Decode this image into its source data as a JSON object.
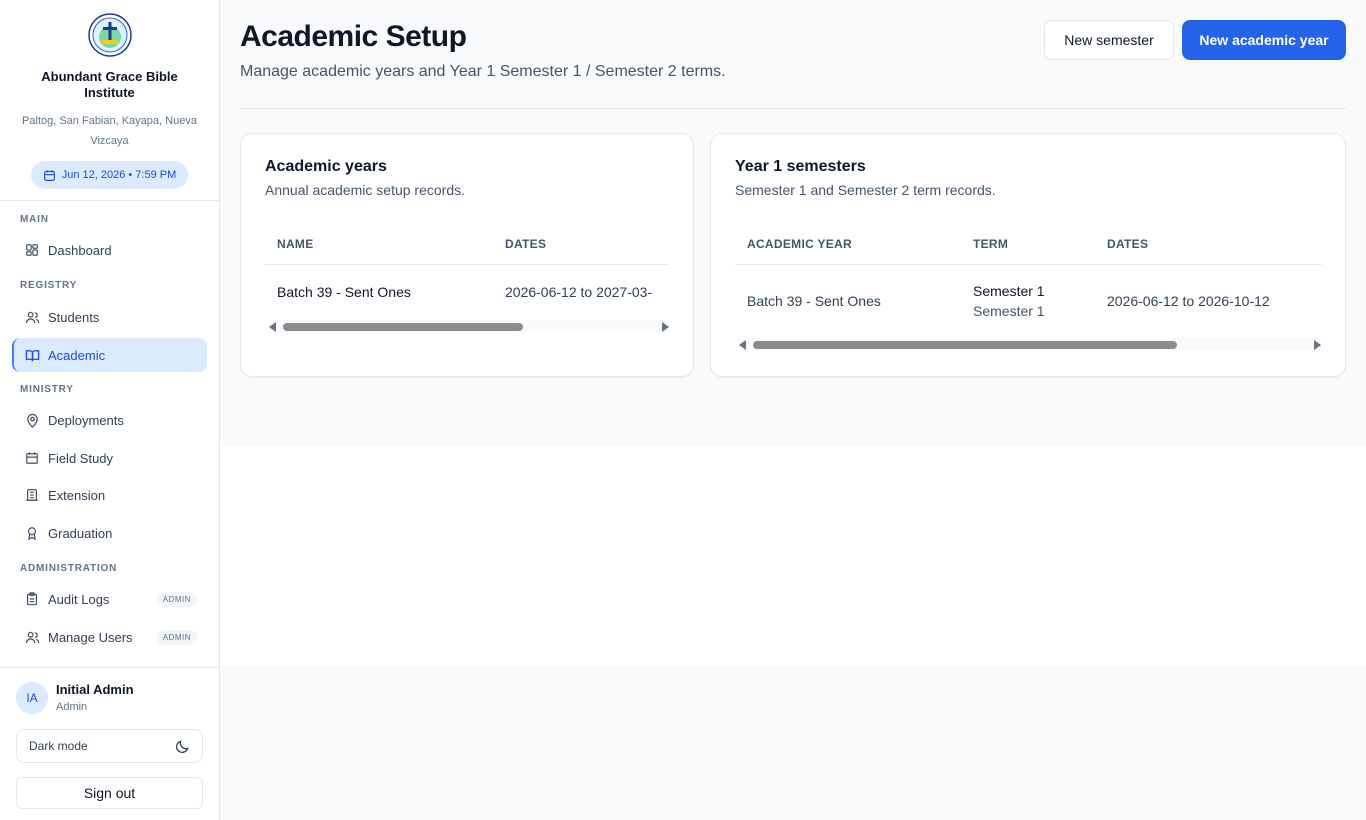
{
  "brand": {
    "name": "Abundant Grace Bible Institute",
    "address": "Paltog, San Fabian, Kayapa, Nueva Vizcaya",
    "datetime": "Jun 12, 2026 • 7:59 PM"
  },
  "nav": {
    "sections": {
      "main": "MAIN",
      "registry": "REGISTRY",
      "ministry": "MINISTRY",
      "administration": "ADMINISTRATION"
    },
    "items": {
      "dashboard": "Dashboard",
      "students": "Students",
      "academic": "Academic",
      "deployments": "Deployments",
      "field_study": "Field Study",
      "extension": "Extension",
      "graduation": "Graduation",
      "audit_logs": "Audit Logs",
      "manage_users": "Manage Users"
    },
    "admin_badge": "ADMIN",
    "active": "academic"
  },
  "user": {
    "initials": "IA",
    "name": "Initial Admin",
    "role": "Admin",
    "dark_mode_label": "Dark mode",
    "sign_out_label": "Sign out"
  },
  "page": {
    "title": "Academic Setup",
    "subtitle": "Manage academic years and Year 1 Semester 1 / Semester 2 terms.",
    "new_semester_label": "New semester",
    "new_academic_year_label": "New academic year"
  },
  "academic_years": {
    "title": "Academic years",
    "subtitle": "Annual academic setup records.",
    "columns": [
      "NAME",
      "DATES"
    ],
    "rows": [
      {
        "name": "Batch 39 - Sent Ones",
        "dates": "2026-06-12 to 2027-03-"
      }
    ]
  },
  "semesters": {
    "title": "Year 1 semesters",
    "subtitle": "Semester 1 and Semester 2 term records.",
    "columns": [
      "ACADEMIC YEAR",
      "TERM",
      "DATES"
    ],
    "rows": [
      {
        "academic_year": "Batch 39 - Sent Ones",
        "term": "Semester 1",
        "term_sub": "Semester 1",
        "dates": "2026-06-12 to 2026-10-12"
      }
    ]
  },
  "colors": {
    "primary": "#2563eb",
    "active_bg": "#dbeafe",
    "active_text": "#1d4ed8"
  }
}
